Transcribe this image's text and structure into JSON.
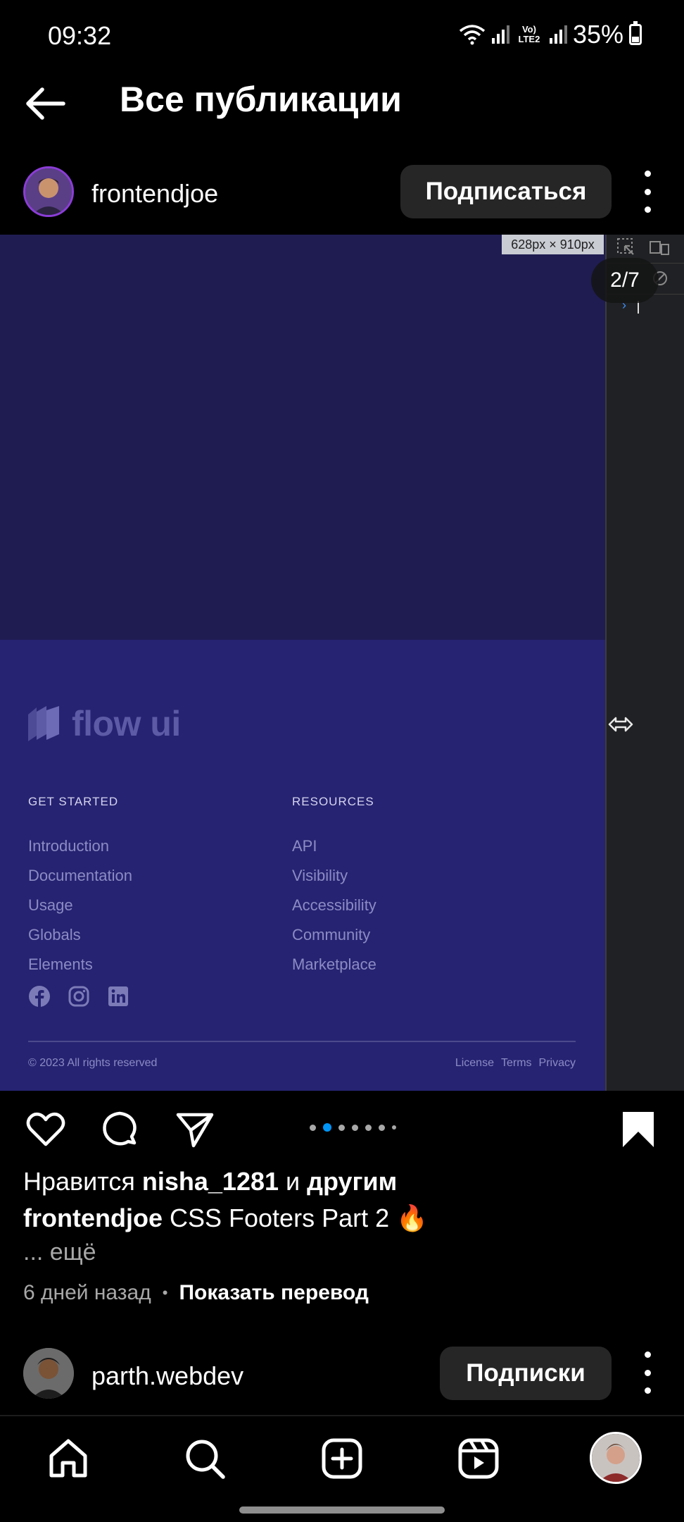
{
  "status_bar": {
    "time": "09:32",
    "network": "Vo) LTE2",
    "battery": "35%",
    "battery_level": 0.35
  },
  "header": {
    "title": "Все публикации",
    "back_icon": "arrow-left-icon"
  },
  "post": {
    "author": "frontendjoe",
    "follow_label": "Подписаться",
    "media_counter": "2/7",
    "dimension_badge": "628px × 910px",
    "carousel": {
      "count": 7,
      "active_index": 1
    },
    "footer_site": {
      "logo_text": "flow ui",
      "columns": [
        {
          "title": "GET STARTED",
          "links": [
            "Introduction",
            "Documentation",
            "Usage",
            "Globals",
            "Elements"
          ]
        },
        {
          "title": "RESOURCES",
          "links": [
            "API",
            "Visibility",
            "Accessibility",
            "Community",
            "Marketplace"
          ]
        }
      ],
      "socials": [
        "facebook-icon",
        "instagram-icon",
        "linkedin-icon"
      ],
      "copyright": "© 2023 All rights reserved",
      "legal_links": [
        "License",
        "Terms",
        "Privacy"
      ]
    },
    "likes": {
      "prefix": "Нравится",
      "user": "nisha_1281",
      "joiner": "и",
      "suffix": "другим"
    },
    "caption": {
      "author": "frontendjoe",
      "text": "CSS Footers Part 2 🔥"
    },
    "more_label": "... ещё",
    "timestamp": "6 дней назад",
    "separator": "•",
    "translate_label": "Показать перевод"
  },
  "next_post": {
    "author": "parth.webdev",
    "follow_label": "Подписки"
  },
  "bottom_nav": [
    "home-icon",
    "search-icon",
    "create-icon",
    "reels-icon",
    "profile-avatar"
  ]
}
